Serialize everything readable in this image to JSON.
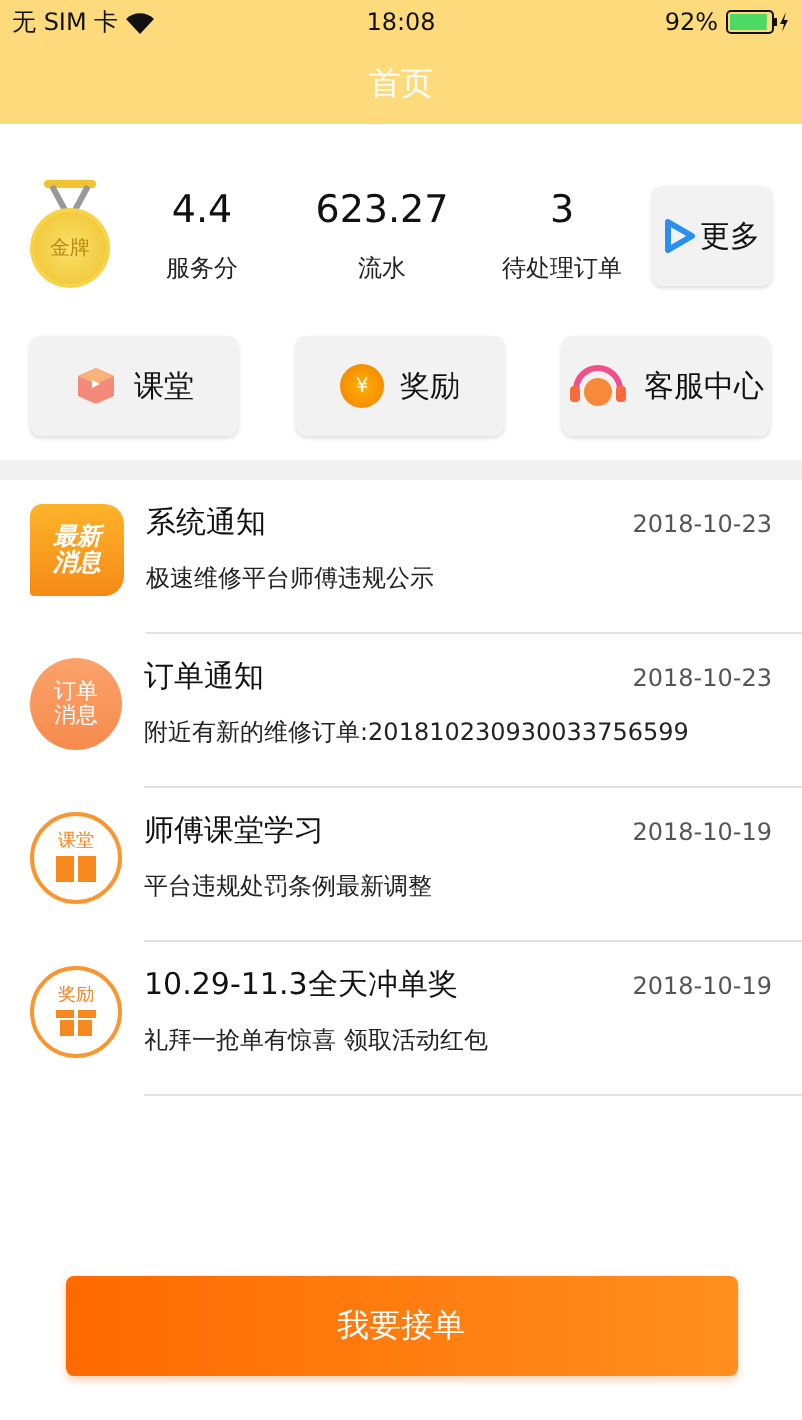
{
  "status_bar": {
    "carrier": "无 SIM 卡",
    "time": "18:08",
    "battery_text": "92%",
    "battery": {
      "level": 0.92,
      "charging": true
    }
  },
  "nav": {
    "title": "首页"
  },
  "stats": {
    "badge": "金牌",
    "items": [
      {
        "value": "4.4",
        "label": "服务分"
      },
      {
        "value": "623.27",
        "label": "流水"
      },
      {
        "value": "3",
        "label": "待处理订单"
      }
    ],
    "more": "更多"
  },
  "quick_actions": [
    {
      "kind": "class",
      "label": "课堂"
    },
    {
      "kind": "reward",
      "label": "奖励",
      "icon_text": "¥"
    },
    {
      "kind": "service",
      "label": "客服中心"
    }
  ],
  "messages": [
    {
      "kind": "latest",
      "icon_text": [
        "最新",
        "消息"
      ],
      "title": "系统通知",
      "date": "2018-10-23",
      "body": "极速维修平台师傅违规公示"
    },
    {
      "kind": "order",
      "icon_text": [
        "订单",
        "消息"
      ],
      "title": "订单通知",
      "date": "2018-10-23",
      "body": "附近有新的维修订单:201810230930033756599"
    },
    {
      "kind": "class",
      "icon_text": [
        "课堂"
      ],
      "title": "师傅课堂学习",
      "date": "2018-10-19",
      "body": "平台违规处罚条例最新调整"
    },
    {
      "kind": "reward",
      "icon_text": [
        "奖励"
      ],
      "title": "10.29-11.3全天冲单奖",
      "date": "2018-10-19",
      "body": "礼拜一抢单有惊喜 领取活动红包"
    }
  ],
  "primary_button": "我要接单"
}
